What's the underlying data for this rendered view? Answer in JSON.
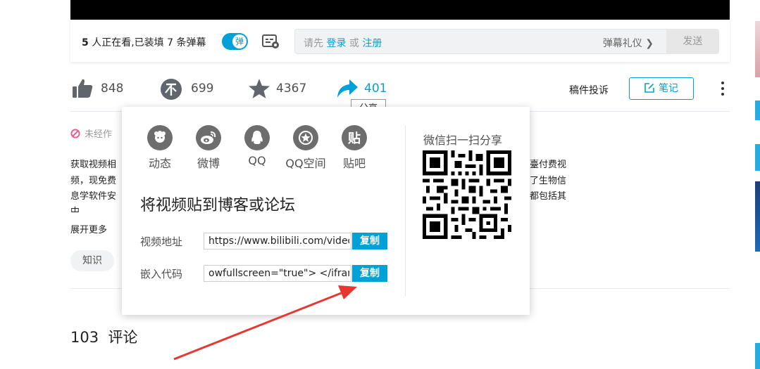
{
  "danmaku": {
    "viewer_count": "5",
    "viewer_text": " 人正在看,已装填 7 条弹幕",
    "toggle_label": "弹",
    "input_prefix": "请先 ",
    "login_link": "登录",
    "or_text": " 或 ",
    "register_link": "注册",
    "etiquette_label": "弹幕礼仪 ❯",
    "send_label": "发送"
  },
  "stats": {
    "like_count": "848",
    "coin_count": "699",
    "favorite_count": "4367",
    "share_count": "401",
    "share_tooltip": "分享",
    "report_label": "稿件投诉",
    "note_label": "笔记"
  },
  "description": {
    "notice": "未经作",
    "line1_left": "获取视频相",
    "line1_right": "臺付费视",
    "line2_left": "频，现免费",
    "line2_right": "了生物信",
    "line3_left": "息学软件安",
    "line3_right": "都包括其",
    "line4_left": "中",
    "expand_label": "展开更多",
    "tag": "知识"
  },
  "comments": {
    "count": "103",
    "label": "评论"
  },
  "share_panel": {
    "platforms": [
      {
        "label": "动态",
        "icon": "dynamic-icon"
      },
      {
        "label": "微博",
        "icon": "weibo-icon"
      },
      {
        "label": "QQ",
        "icon": "qq-icon"
      },
      {
        "label": "QQ空间",
        "icon": "qzone-icon"
      },
      {
        "label": "贴吧",
        "icon": "tieba-icon"
      }
    ],
    "tieba_glyph": "贴",
    "heading": "将视频贴到博客或论坛",
    "video_url_label": "视频地址",
    "video_url_value": "https://www.bilibili.com/video/B",
    "embed_label": "嵌入代码",
    "embed_value": "owfullscreen=\"true\"> </iframe>",
    "copy_label": "复制",
    "qr_title": "微信扫一扫分享"
  },
  "colors": {
    "accent": "#00a1d6",
    "annotation_arrow": "#e8372f"
  }
}
